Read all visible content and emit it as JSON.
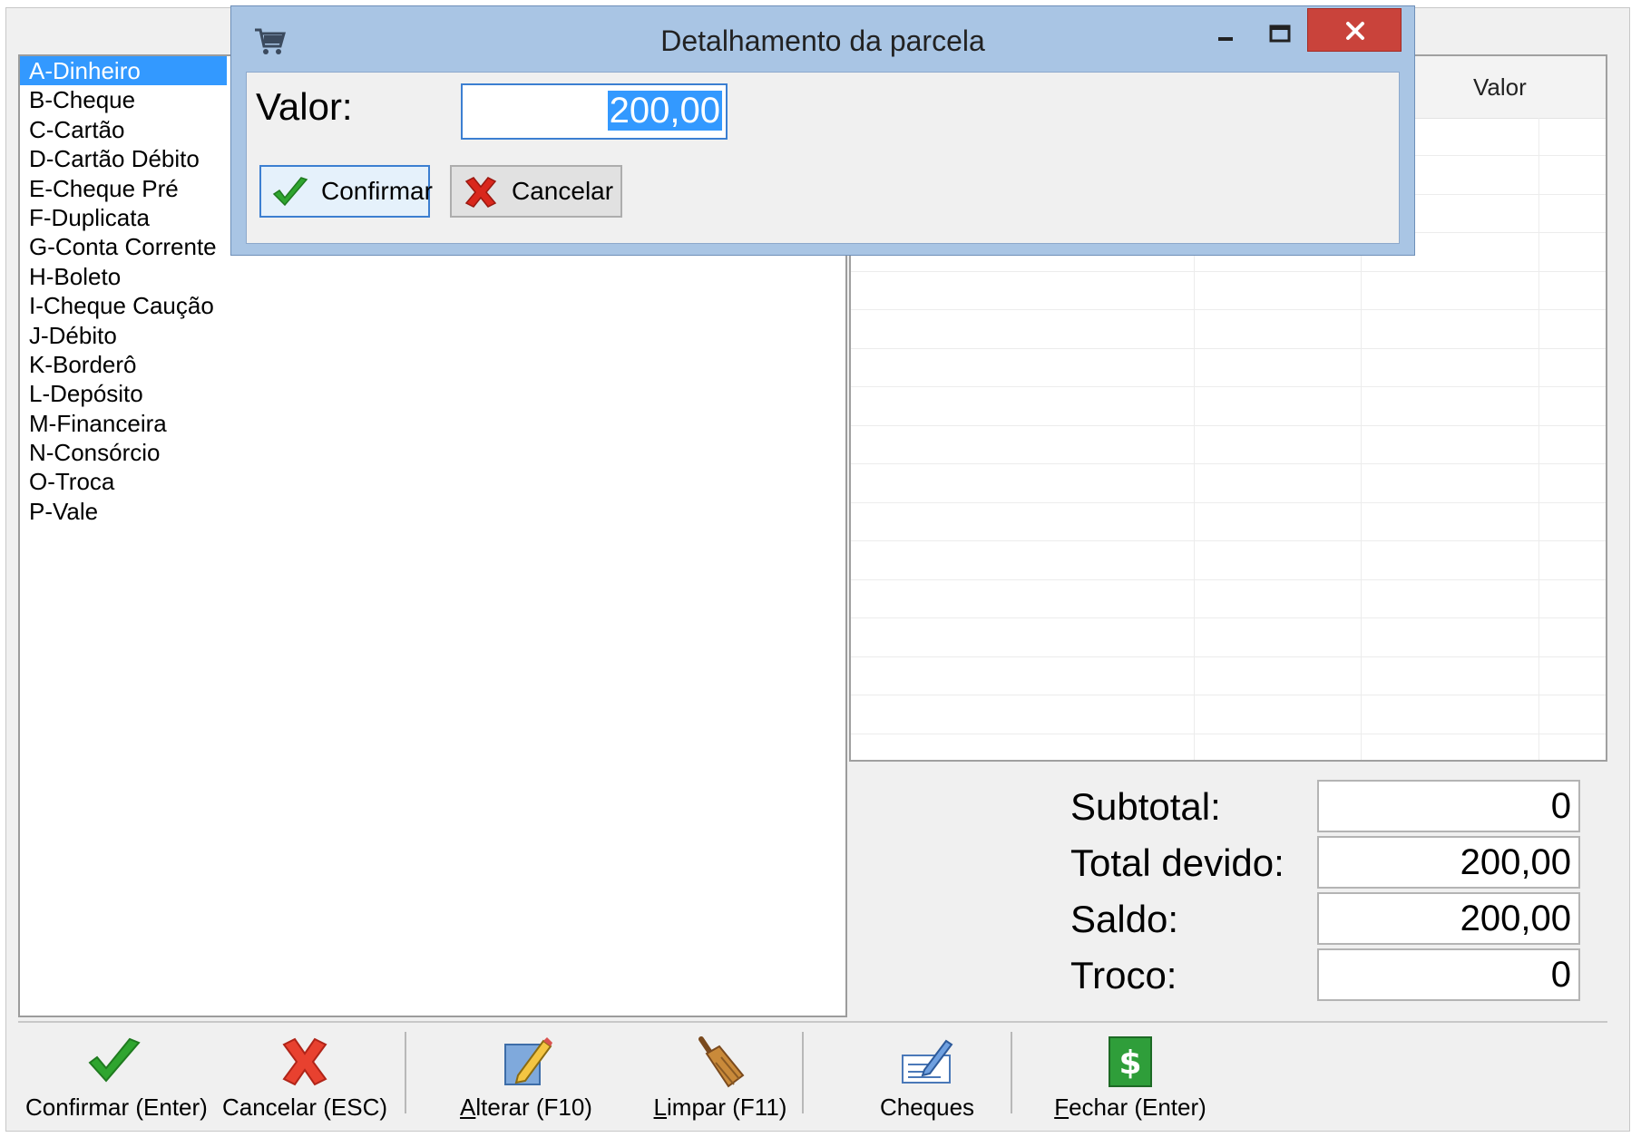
{
  "dialog": {
    "title": "Detalhamento da parcela",
    "valor_label": "Valor:",
    "valor_value": "200,00",
    "confirm_label": "Confirmar",
    "cancel_label": "Cancelar"
  },
  "payment_types": [
    "A-Dinheiro",
    "B-Cheque",
    "C-Cartão",
    "D-Cartão Débito",
    "E-Cheque Pré",
    "F-Duplicata",
    "G-Conta Corrente",
    "H-Boleto",
    "I-Cheque Caução",
    "J-Débito",
    "K-Borderô",
    "L-Depósito",
    "M-Financeira",
    "N-Consórcio",
    "O-Troca",
    "P-Vale"
  ],
  "selected_payment": "A-Dinheiro",
  "grid": {
    "value_header": "Valor"
  },
  "totals": {
    "subtotal_label": "Subtotal:",
    "subtotal_value": "0",
    "total_devido_label": "Total devido:",
    "total_devido_value": "200,00",
    "saldo_label": "Saldo:",
    "saldo_value": "200,00",
    "troco_label": "Troco:",
    "troco_value": "0"
  },
  "toolbar": {
    "confirmar": "Confirmar (Enter)",
    "cancelar": "Cancelar (ESC)",
    "alterar_accel": "A",
    "alterar_rest": "lterar (F10)",
    "limpar_accel": "L",
    "limpar_rest": "impar (F11)",
    "cheques": "Cheques",
    "fechar_accel": "F",
    "fechar_rest": "echar (Enter)"
  },
  "icons": {
    "cart": "cart-icon",
    "check": "check-icon",
    "cross": "cross-icon",
    "pencil": "pencil-icon",
    "broom": "broom-icon",
    "cheque": "cheque-icon",
    "money": "dollar-bill-icon"
  },
  "colors": {
    "selection": "#3399ff",
    "dialog_frame": "#a9c5e4",
    "close_button": "#c9433b",
    "check_green": "#2fa52f",
    "cross_red": "#d9271c"
  }
}
